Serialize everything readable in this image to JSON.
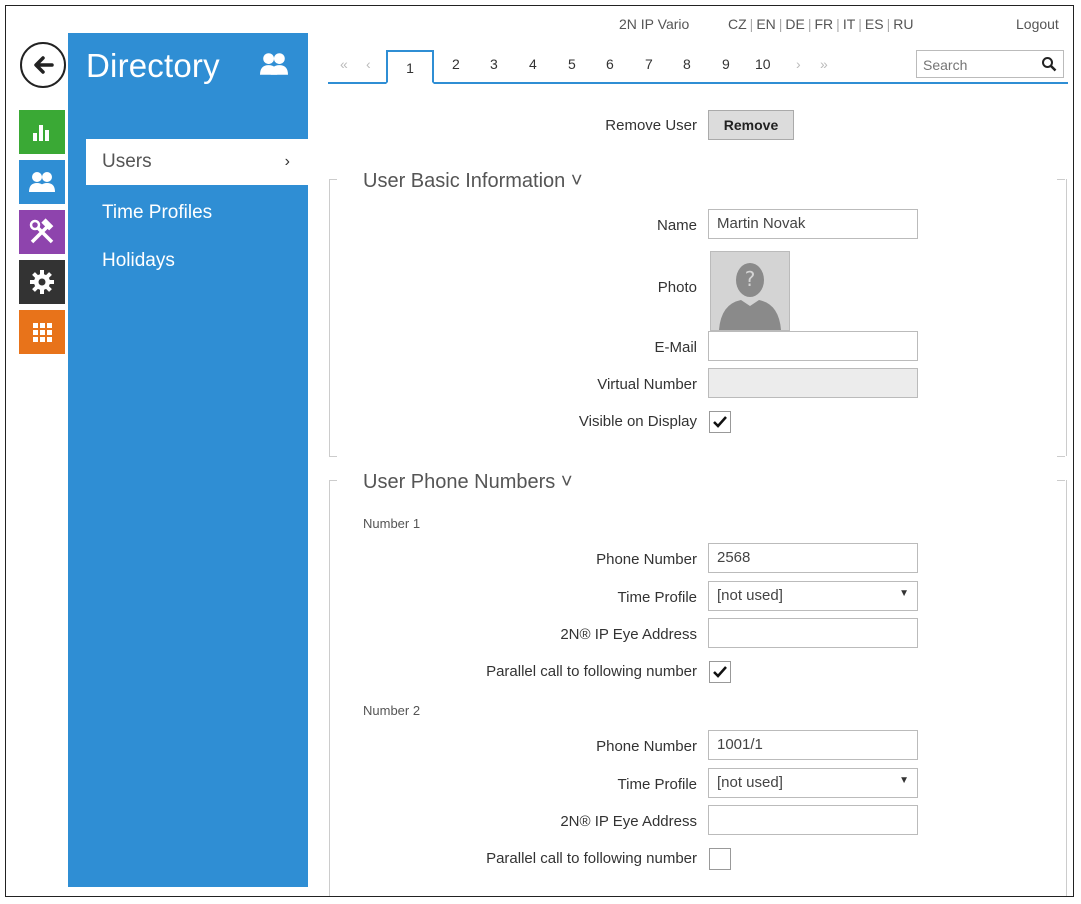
{
  "topbar": {
    "device": "2N IP Vario",
    "languages": [
      "CZ",
      "EN",
      "DE",
      "FR",
      "IT",
      "ES",
      "RU"
    ],
    "logout": "Logout"
  },
  "sidebar": {
    "title": "Directory",
    "items": [
      {
        "label": "Users",
        "chevron": "›"
      },
      {
        "label": "Time Profiles"
      },
      {
        "label": "Holidays"
      }
    ]
  },
  "rail": {
    "icons": [
      {
        "name": "status-chart-icon",
        "color": "#3aa935"
      },
      {
        "name": "directory-users-icon",
        "color": "#2f8ed4"
      },
      {
        "name": "hardware-tools-icon",
        "color": "#8e44ad"
      },
      {
        "name": "settings-gear-icon",
        "color": "#333333"
      },
      {
        "name": "services-grid-icon",
        "color": "#e8731a"
      }
    ]
  },
  "pager": {
    "first": "«",
    "prev": "‹",
    "active": "1",
    "pages": [
      "2",
      "3",
      "4",
      "5",
      "6",
      "7",
      "8",
      "9",
      "10"
    ],
    "next": "›",
    "last": "»",
    "search_placeholder": "Search"
  },
  "remove": {
    "label": "Remove User",
    "button": "Remove"
  },
  "basic": {
    "title": "User Basic Information ˅",
    "name_label": "Name",
    "name_value": "Martin Novak",
    "photo_label": "Photo",
    "email_label": "E-Mail",
    "email_value": "",
    "virtual_label": "Virtual Number",
    "virtual_value": "",
    "visible_label": "Visible on Display",
    "visible_checked": true
  },
  "phones": {
    "title": "User Phone Numbers ˅",
    "numbers": [
      {
        "heading": "Number 1",
        "phone_label": "Phone Number",
        "phone_value": "2568",
        "profile_label": "Time Profile",
        "profile_value": "[not used]",
        "eye_label": "2N® IP Eye Address",
        "eye_value": "",
        "parallel_label": "Parallel call to following number",
        "parallel_checked": true
      },
      {
        "heading": "Number 2",
        "phone_label": "Phone Number",
        "phone_value": "1001/1",
        "profile_label": "Time Profile",
        "profile_value": "[not used]",
        "eye_label": "2N® IP Eye Address",
        "eye_value": "",
        "parallel_label": "Parallel call to following number",
        "parallel_checked": false
      }
    ]
  }
}
